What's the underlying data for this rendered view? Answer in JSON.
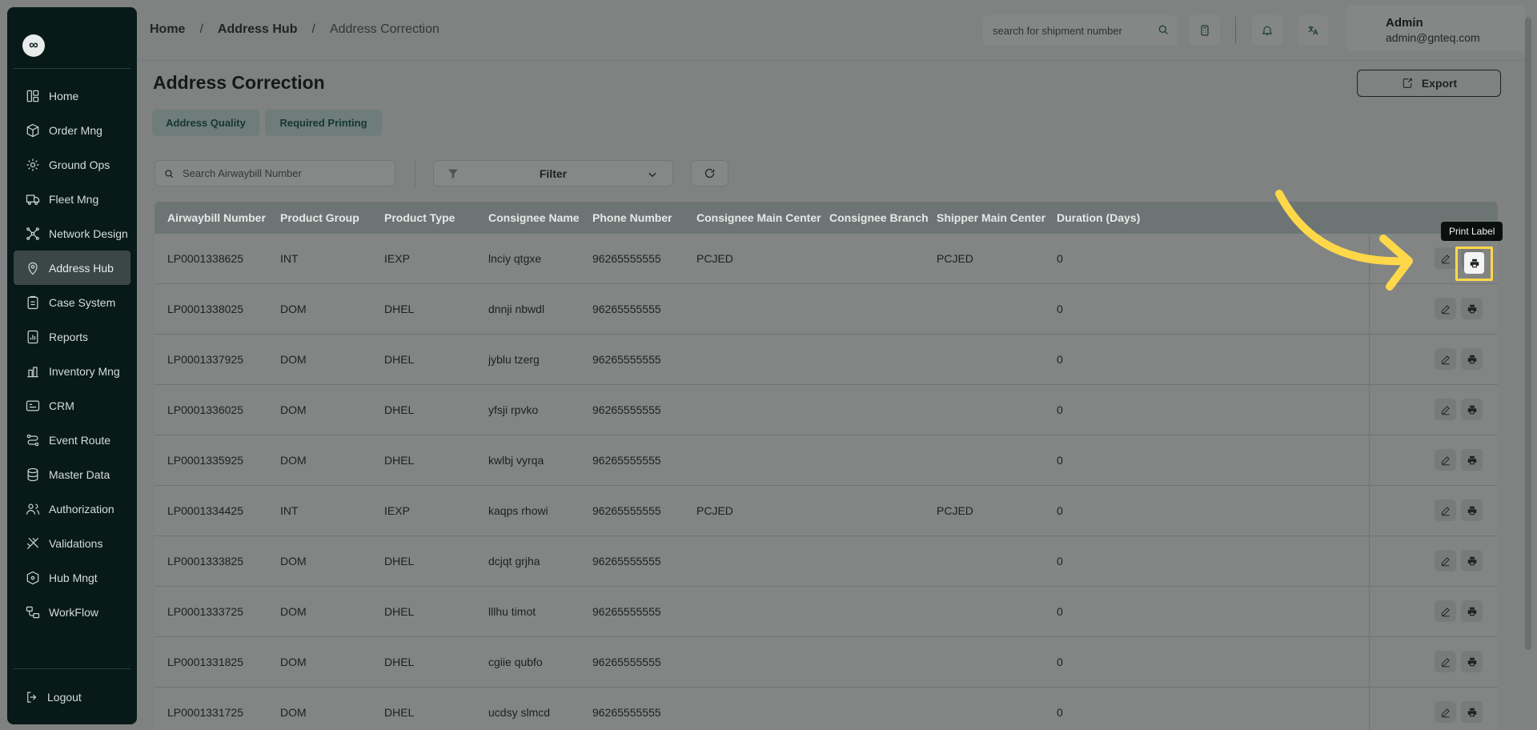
{
  "sidebar": {
    "logo": "∞",
    "items": [
      {
        "label": "Home",
        "icon": "grid-icon"
      },
      {
        "label": "Order Mng",
        "icon": "box-icon"
      },
      {
        "label": "Ground Ops",
        "icon": "cog-icon"
      },
      {
        "label": "Fleet Mng",
        "icon": "truck-icon"
      },
      {
        "label": "Network Design",
        "icon": "network-icon"
      },
      {
        "label": "Address Hub",
        "icon": "location-icon",
        "active": true
      },
      {
        "label": "Case System",
        "icon": "case-icon"
      },
      {
        "label": "Reports",
        "icon": "report-icon"
      },
      {
        "label": "Inventory Mng",
        "icon": "inventory-icon"
      },
      {
        "label": "CRM",
        "icon": "crm-icon"
      },
      {
        "label": "Event Route",
        "icon": "route-icon"
      },
      {
        "label": "Master Data",
        "icon": "database-icon"
      },
      {
        "label": "Authorization",
        "icon": "users-icon"
      },
      {
        "label": "Validations",
        "icon": "validation-icon"
      },
      {
        "label": "Hub Mngt",
        "icon": "hub-icon"
      },
      {
        "label": "WorkFlow",
        "icon": "workflow-icon"
      }
    ],
    "logout": "Logout"
  },
  "header": {
    "breadcrumb": [
      "Home",
      "Address Hub",
      "Address Correction"
    ],
    "search_placeholder": "search for shipment number",
    "user_name": "Admin",
    "user_email": "admin@gnteq.com"
  },
  "page": {
    "title": "Address Correction",
    "export_label": "Export",
    "tabs": [
      "Address Quality",
      "Required Printing"
    ],
    "search_placeholder": "Search Airwaybill Number",
    "filter_label": "Filter",
    "tooltip": "Print Label"
  },
  "table": {
    "columns": [
      "Airwaybill Number",
      "Product Group",
      "Product Type",
      "Consignee Name",
      "Phone Number",
      "Consignee Main Center",
      "Consignee Branch",
      "Shipper Main Center",
      "Duration (Days)"
    ],
    "rows": [
      [
        "LP0001338625",
        "INT",
        "IEXP",
        "lnciy qtgxe",
        "96265555555",
        "PCJED",
        "",
        "PCJED",
        "0"
      ],
      [
        "LP0001338025",
        "DOM",
        "DHEL",
        "dnnji nbwdl",
        "96265555555",
        "",
        "",
        "",
        "0"
      ],
      [
        "LP0001337925",
        "DOM",
        "DHEL",
        "jyblu tzerg",
        "96265555555",
        "",
        "",
        "",
        "0"
      ],
      [
        "LP0001336025",
        "DOM",
        "DHEL",
        "yfsji rpvko",
        "96265555555",
        "",
        "",
        "",
        "0"
      ],
      [
        "LP0001335925",
        "DOM",
        "DHEL",
        "kwlbj vyrqa",
        "96265555555",
        "",
        "",
        "",
        "0"
      ],
      [
        "LP0001334425",
        "INT",
        "IEXP",
        "kaqps rhowi",
        "96265555555",
        "PCJED",
        "",
        "PCJED",
        "0"
      ],
      [
        "LP0001333825",
        "DOM",
        "DHEL",
        "dcjqt grjha",
        "96265555555",
        "",
        "",
        "",
        "0"
      ],
      [
        "LP0001333725",
        "DOM",
        "DHEL",
        "lllhu timot",
        "96265555555",
        "",
        "",
        "",
        "0"
      ],
      [
        "LP0001331825",
        "DOM",
        "DHEL",
        "cgiie qubfo",
        "96265555555",
        "",
        "",
        "",
        "0"
      ],
      [
        "LP0001331725",
        "DOM",
        "DHEL",
        "ucdsy slmcd",
        "96265555555",
        "",
        "",
        "",
        "0"
      ]
    ]
  },
  "colors": {
    "sidebar_bg": "#071a18",
    "overlay_bg": "#7f8281",
    "highlight": "#ffd84a",
    "tab_bg": "#6e7d7a"
  }
}
